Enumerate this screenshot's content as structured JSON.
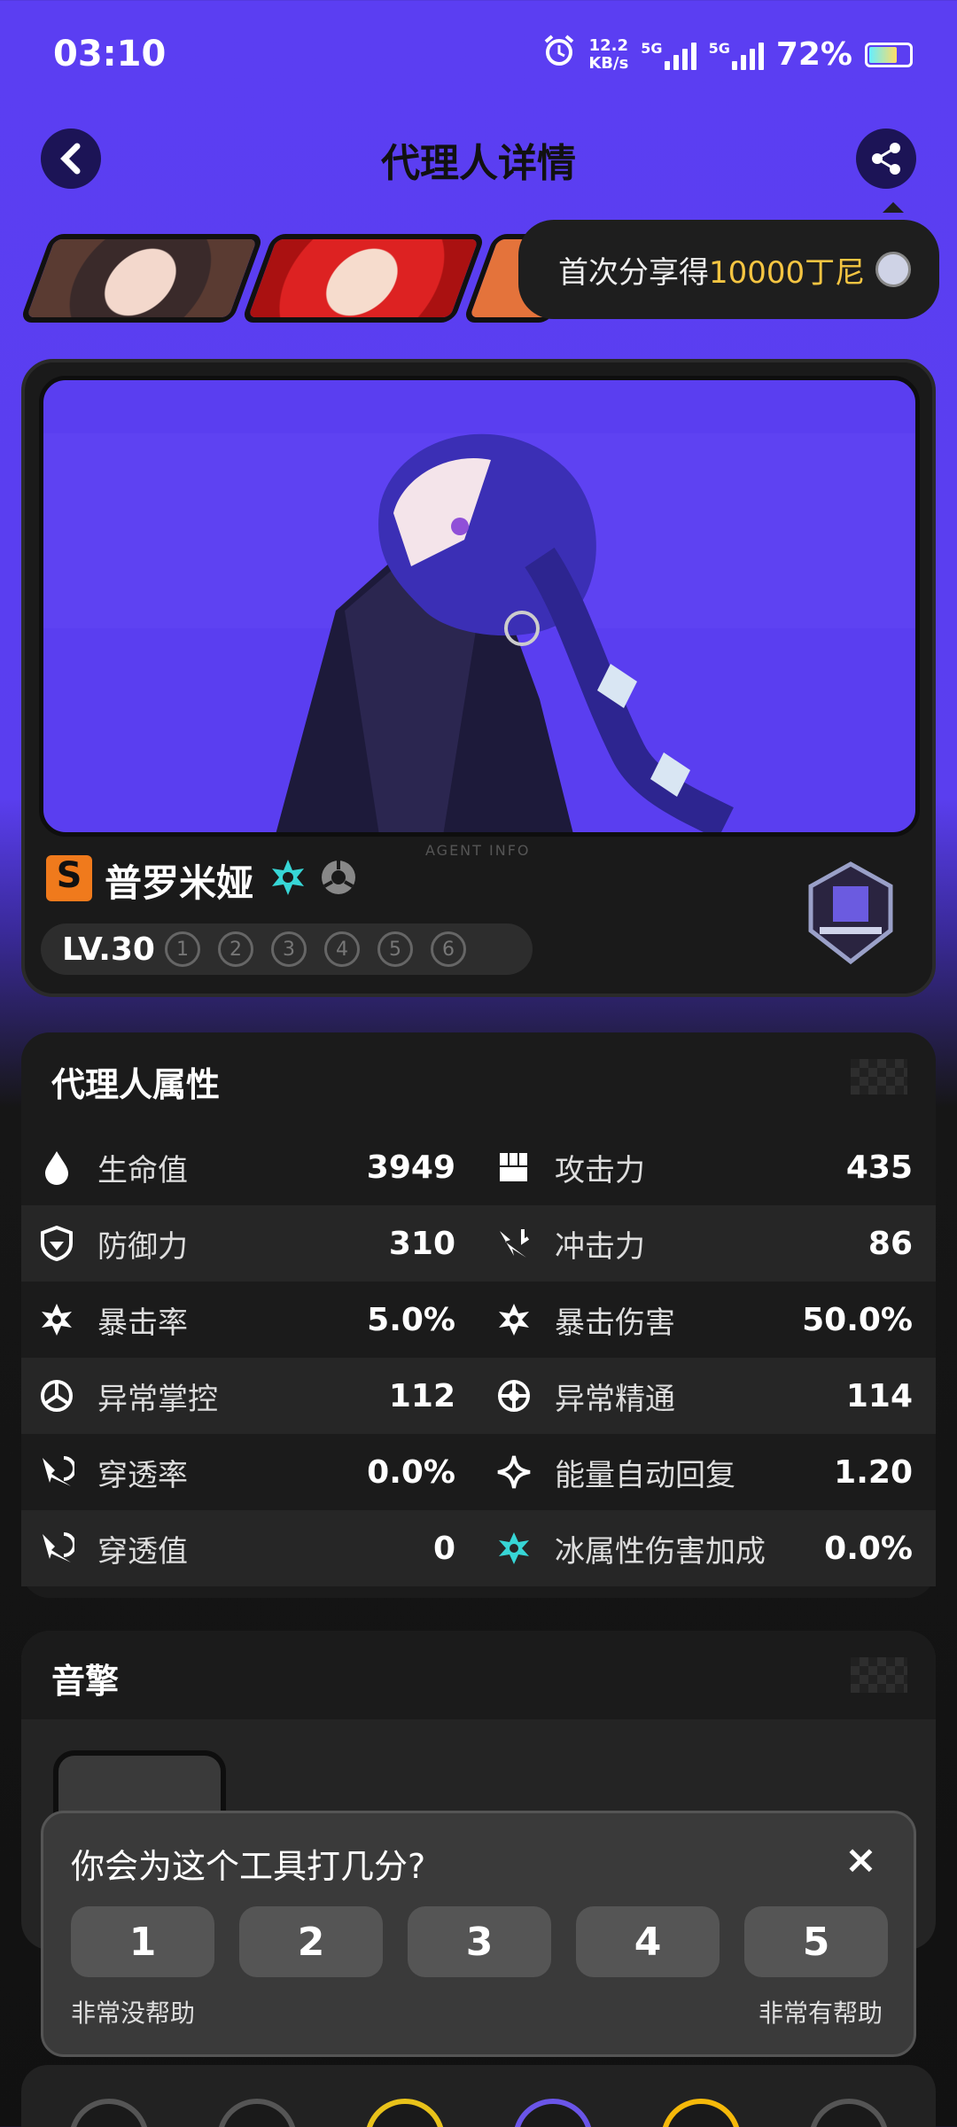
{
  "status_bar": {
    "time": "03:10",
    "net_speed_value": "12.2",
    "net_speed_unit": "KB/s",
    "sim1": "5G",
    "sim2": "5G",
    "battery": "72%"
  },
  "header": {
    "title": "代理人详情"
  },
  "tooltip": {
    "prefix": "首次分享得",
    "highlight": "10000丁尼"
  },
  "agent": {
    "rank": "S",
    "name": "普罗米娅",
    "level": "LV.30",
    "mindscape": [
      "1",
      "2",
      "3",
      "4",
      "5",
      "6"
    ],
    "watermark": "AGENT INFO"
  },
  "attributes": {
    "title": "代理人属性",
    "rows": [
      {
        "l_label": "生命值",
        "l_value": "3949",
        "r_label": "攻击力",
        "r_value": "435"
      },
      {
        "l_label": "防御力",
        "l_value": "310",
        "r_label": "冲击力",
        "r_value": "86"
      },
      {
        "l_label": "暴击率",
        "l_value": "5.0%",
        "r_label": "暴击伤害",
        "r_value": "50.0%"
      },
      {
        "l_label": "异常掌控",
        "l_value": "112",
        "r_label": "异常精通",
        "r_value": "114"
      },
      {
        "l_label": "穿透率",
        "l_value": "0.0%",
        "r_label": "能量自动回复",
        "r_value": "1.20"
      },
      {
        "l_label": "穿透值",
        "l_value": "0",
        "r_label": "冰属性伤害加成",
        "r_value": "0.0%"
      }
    ]
  },
  "engine": {
    "title": "音擎"
  },
  "rating": {
    "question": "你会为这个工具打几分?",
    "close": "×",
    "scores": [
      "1",
      "2",
      "3",
      "4",
      "5"
    ],
    "low_label": "非常没帮助",
    "high_label": "非常有帮助"
  },
  "colors": {
    "bg": "#5b3ef2",
    "accent_yellow": "#f5c542",
    "rank_orange": "#f07a1c",
    "ice": "#37d6d6"
  }
}
